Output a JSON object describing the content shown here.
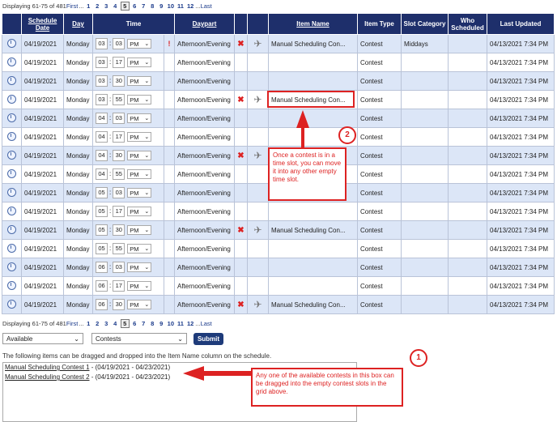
{
  "pager_top": {
    "displaying": "Displaying 61-75 of 481",
    "first": "First",
    "pages": [
      "1",
      "2",
      "3",
      "4",
      "5",
      "6",
      "7",
      "8",
      "9",
      "10",
      "11",
      "12"
    ],
    "current": "5",
    "ellipsis": "...",
    "last": "Last"
  },
  "pager_bottom": {
    "displaying": "Displaying 61-75 of 481",
    "first": "First",
    "pages": [
      "1",
      "2",
      "3",
      "4",
      "5",
      "6",
      "7",
      "8",
      "9",
      "10",
      "11",
      "12"
    ],
    "current": "5",
    "ellipsis": "...",
    "last": "Last"
  },
  "columns": {
    "date": "Schedule Date",
    "day": "Day",
    "time": "Time",
    "daypart": "Daypart",
    "item": "Item Name",
    "type": "Item Type",
    "category": "Slot Category",
    "who": "Who Scheduled",
    "updated": "Last Updated"
  },
  "rows": [
    {
      "date": "04/19/2021",
      "day": "Monday",
      "hour": "03",
      "minute": "03",
      "ampm": "PM",
      "warn": "!",
      "daypart": "Afternoon/Evening",
      "del": "✖",
      "thumb": true,
      "item": "Manual Scheduling Con...",
      "type": "Contest",
      "category": "Middays",
      "updated": "04/13/2021 7:34 PM"
    },
    {
      "date": "04/19/2021",
      "day": "Monday",
      "hour": "03",
      "minute": "17",
      "ampm": "PM",
      "warn": "",
      "daypart": "Afternoon/Evening",
      "del": "",
      "thumb": false,
      "item": "",
      "type": "Contest",
      "category": "",
      "updated": "04/13/2021 7:34 PM"
    },
    {
      "date": "04/19/2021",
      "day": "Monday",
      "hour": "03",
      "minute": "30",
      "ampm": "PM",
      "warn": "",
      "daypart": "Afternoon/Evening",
      "del": "",
      "thumb": false,
      "item": "",
      "type": "Contest",
      "category": "",
      "updated": "04/13/2021 7:34 PM"
    },
    {
      "date": "04/19/2021",
      "day": "Monday",
      "hour": "03",
      "minute": "55",
      "ampm": "PM",
      "warn": "",
      "daypart": "Afternoon/Evening",
      "del": "✖",
      "thumb": true,
      "item": "Manual Scheduling Con...",
      "type": "Contest",
      "category": "",
      "updated": "04/13/2021 7:34 PM"
    },
    {
      "date": "04/19/2021",
      "day": "Monday",
      "hour": "04",
      "minute": "03",
      "ampm": "PM",
      "warn": "",
      "daypart": "Afternoon/Evening",
      "del": "",
      "thumb": false,
      "item": "",
      "type": "Contest",
      "category": "",
      "updated": "04/13/2021 7:34 PM"
    },
    {
      "date": "04/19/2021",
      "day": "Monday",
      "hour": "04",
      "minute": "17",
      "ampm": "PM",
      "warn": "",
      "daypart": "Afternoon/Evening",
      "del": "",
      "thumb": false,
      "item": "",
      "type": "Contest",
      "category": "",
      "updated": "04/13/2021 7:34 PM"
    },
    {
      "date": "04/19/2021",
      "day": "Monday",
      "hour": "04",
      "minute": "30",
      "ampm": "PM",
      "warn": "",
      "daypart": "Afternoon/Evening",
      "del": "✖",
      "thumb": true,
      "item": "",
      "type": "Contest",
      "category": "",
      "updated": "04/13/2021 7:34 PM"
    },
    {
      "date": "04/19/2021",
      "day": "Monday",
      "hour": "04",
      "minute": "55",
      "ampm": "PM",
      "warn": "",
      "daypart": "Afternoon/Evening",
      "del": "",
      "thumb": false,
      "item": "",
      "type": "Contest",
      "category": "",
      "updated": "04/13/2021 7:34 PM"
    },
    {
      "date": "04/19/2021",
      "day": "Monday",
      "hour": "05",
      "minute": "03",
      "ampm": "PM",
      "warn": "",
      "daypart": "Afternoon/Evening",
      "del": "",
      "thumb": false,
      "item": "",
      "type": "Contest",
      "category": "",
      "updated": "04/13/2021 7:34 PM"
    },
    {
      "date": "04/19/2021",
      "day": "Monday",
      "hour": "05",
      "minute": "17",
      "ampm": "PM",
      "warn": "",
      "daypart": "Afternoon/Evening",
      "del": "",
      "thumb": false,
      "item": "",
      "type": "Contest",
      "category": "",
      "updated": "04/13/2021 7:34 PM"
    },
    {
      "date": "04/19/2021",
      "day": "Monday",
      "hour": "05",
      "minute": "30",
      "ampm": "PM",
      "warn": "",
      "daypart": "Afternoon/Evening",
      "del": "✖",
      "thumb": true,
      "item": "Manual Scheduling Con...",
      "type": "Contest",
      "category": "",
      "updated": "04/13/2021 7:34 PM"
    },
    {
      "date": "04/19/2021",
      "day": "Monday",
      "hour": "05",
      "minute": "55",
      "ampm": "PM",
      "warn": "",
      "daypart": "Afternoon/Evening",
      "del": "",
      "thumb": false,
      "item": "",
      "type": "Contest",
      "category": "",
      "updated": "04/13/2021 7:34 PM"
    },
    {
      "date": "04/19/2021",
      "day": "Monday",
      "hour": "06",
      "minute": "03",
      "ampm": "PM",
      "warn": "",
      "daypart": "Afternoon/Evening",
      "del": "",
      "thumb": false,
      "item": "",
      "type": "Contest",
      "category": "",
      "updated": "04/13/2021 7:34 PM"
    },
    {
      "date": "04/19/2021",
      "day": "Monday",
      "hour": "06",
      "minute": "17",
      "ampm": "PM",
      "warn": "",
      "daypart": "Afternoon/Evening",
      "del": "",
      "thumb": false,
      "item": "",
      "type": "Contest",
      "category": "",
      "updated": "04/13/2021 7:34 PM"
    },
    {
      "date": "04/19/2021",
      "day": "Monday",
      "hour": "06",
      "minute": "30",
      "ampm": "PM",
      "warn": "",
      "daypart": "Afternoon/Evening",
      "del": "✖",
      "thumb": true,
      "item": "Manual Scheduling Con...",
      "type": "Contest",
      "category": "",
      "updated": "04/13/2021 7:34 PM"
    }
  ],
  "filters": {
    "status": "Available",
    "itemtype": "Contests",
    "submit": "Submit"
  },
  "instructions": "The following items can be dragged and dropped into the Item Name column on the schedule.",
  "available_items": [
    {
      "name": "Manual Scheduling Contest 1",
      "dates": " - (04/19/2021 - 04/23/2021)"
    },
    {
      "name": "Manual Scheduling Contest 2",
      "dates": " - (04/19/2021 - 04/23/2021)"
    }
  ],
  "callouts": {
    "one": {
      "num": "1",
      "text": "Any one of the available contests in this box can be dragged into the empty contest slots in the grid above."
    },
    "two": {
      "num": "2",
      "text": "Once a contest is in a time slot, you can move it into any other empty time slot."
    }
  },
  "colors": {
    "header": "#1e2f6b",
    "alt_row": "#dce6f7",
    "annotation": "#d22222"
  }
}
